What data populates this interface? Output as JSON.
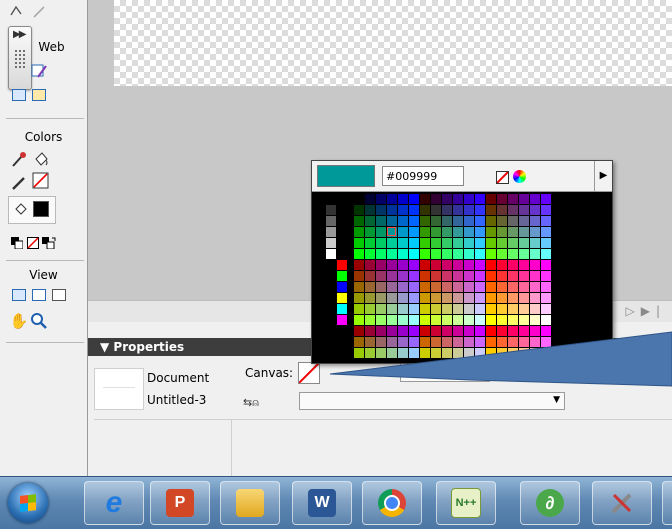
{
  "tools_panel": {
    "sections": {
      "web": "Web",
      "colors": "Colors",
      "view": "View"
    }
  },
  "properties": {
    "header": "Properties",
    "doc_type": "Document",
    "doc_name": "Untitled-3",
    "canvas_label": "Canvas:"
  },
  "swatch_popup": {
    "hex_value": "#009999",
    "current_color": "#009999"
  },
  "taskbar": {
    "apps": [
      "internet-explorer",
      "powerpoint",
      "folder",
      "word",
      "chrome",
      "notepad-plus-plus",
      "dreamweaver",
      "tools"
    ]
  }
}
